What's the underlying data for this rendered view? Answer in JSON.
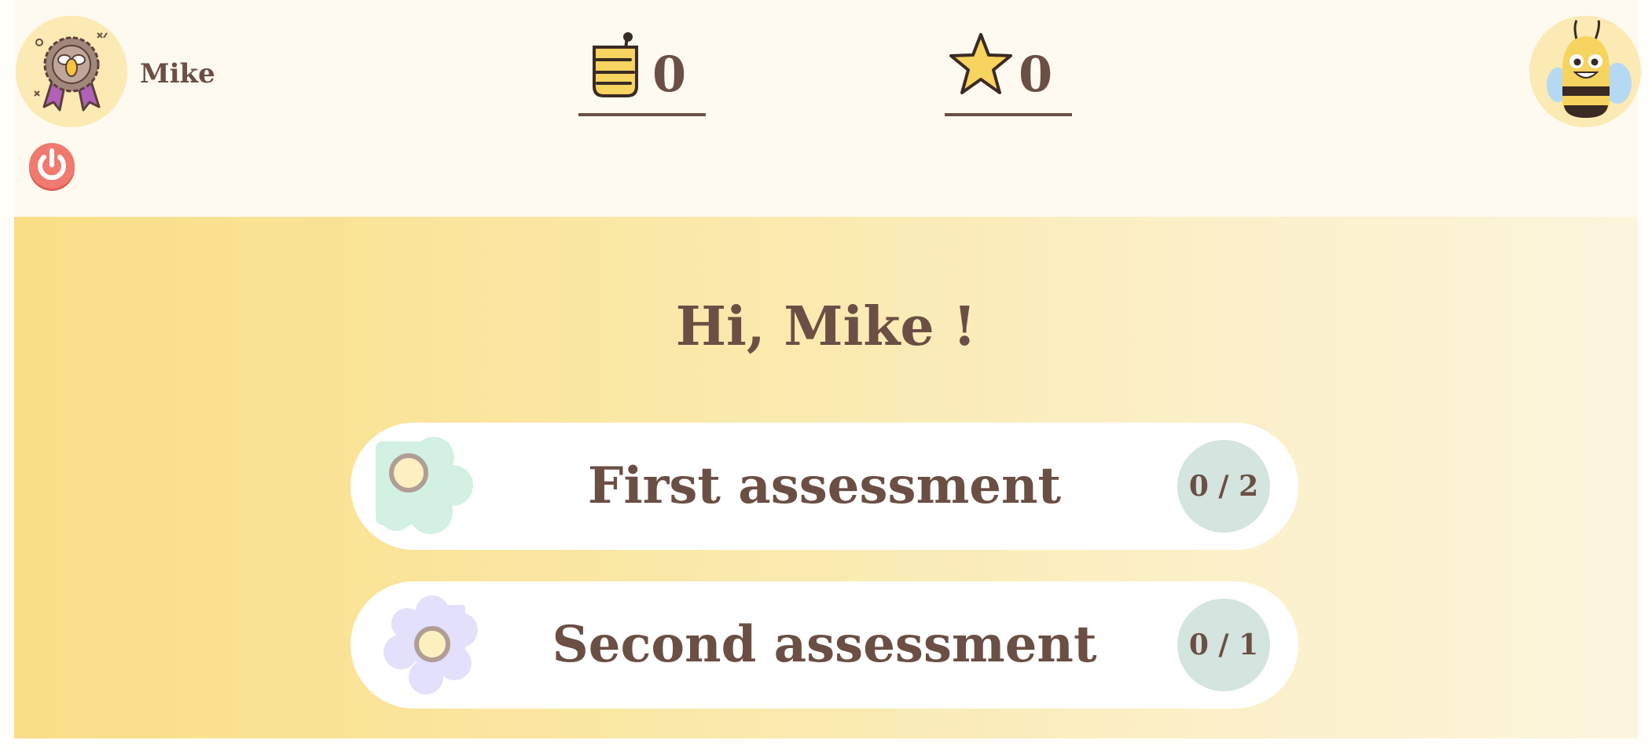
{
  "user": {
    "name": "Mike",
    "avatar_icon": "bee-award-badge-icon"
  },
  "counters": {
    "honey": {
      "icon": "honey-dipper-icon",
      "value": "0"
    },
    "stars": {
      "icon": "star-icon",
      "value": "0"
    }
  },
  "mascot": {
    "icon": "smiling-bee-icon"
  },
  "logout": {
    "icon": "power-icon"
  },
  "greeting": "Hi, Mike !",
  "assessments": [
    {
      "title": "First assessment",
      "progress": "0 / 2",
      "icon": "green-flower-icon"
    },
    {
      "title": "Second assessment",
      "progress": "0 / 1",
      "icon": "lavender-flower-icon"
    }
  ],
  "colors": {
    "text_brown": "#6b4f44",
    "honey_yellow": "#f7d35f",
    "power_red": "#ec7268",
    "badge_teal": "#d4e4df",
    "flower_green": "#d2f1e2",
    "flower_lavender": "#e2e0fb"
  }
}
